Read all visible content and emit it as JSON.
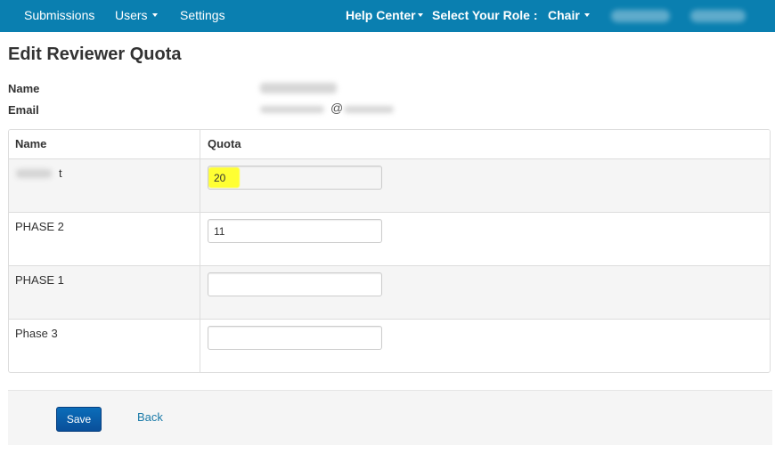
{
  "navbar": {
    "submissions": "Submissions",
    "users": "Users",
    "settings": "Settings",
    "help_center": "Help Center",
    "select_role": "Select Your Role :",
    "role": "Chair"
  },
  "page": {
    "title": "Edit Reviewer Quota"
  },
  "info": {
    "name_label": "Name",
    "email_label": "Email",
    "email_at": "@"
  },
  "table": {
    "headers": {
      "name": "Name",
      "quota": "Quota"
    },
    "rows": [
      {
        "name": "t",
        "quota": "20"
      },
      {
        "name": "PHASE 2",
        "quota": "11"
      },
      {
        "name": "PHASE 1",
        "quota": ""
      },
      {
        "name": "Phase 3",
        "quota": ""
      }
    ]
  },
  "actions": {
    "save_label": "Save",
    "back_label": "Back"
  },
  "colors": {
    "navbar": "#0a7fb0",
    "primary_button": "#0b6db9",
    "highlight": "#ffff33",
    "link": "#1a7aa8"
  }
}
